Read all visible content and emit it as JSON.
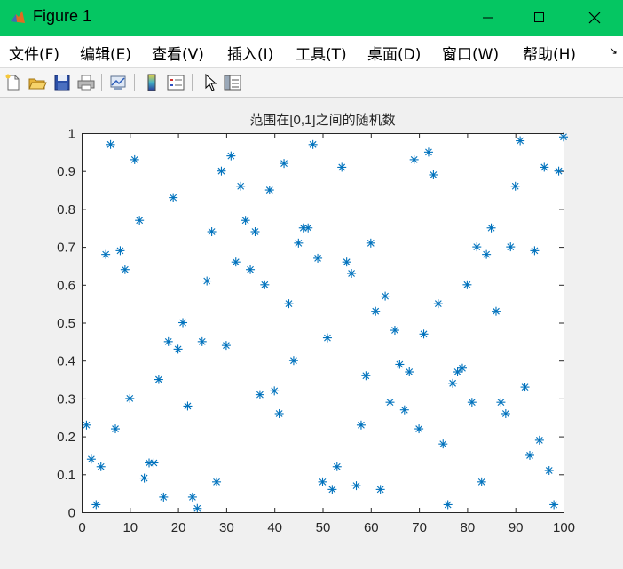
{
  "window": {
    "title": "Figure 1",
    "controls": [
      "minimize",
      "maximize",
      "close"
    ]
  },
  "menu": {
    "items": [
      "文件(F)",
      "编辑(E)",
      "查看(V)",
      "插入(I)",
      "工具(T)",
      "桌面(D)",
      "窗口(W)",
      "帮助(H)"
    ]
  },
  "toolbar": {
    "icons": [
      "new-figure-icon",
      "open-file-icon",
      "save-icon",
      "print-icon",
      "link-plot-icon",
      "colorbar-icon",
      "legend-icon",
      "pointer-icon",
      "property-inspector-icon"
    ]
  },
  "colors": {
    "titlebar": "#05c662",
    "marker": "#0072bd",
    "axes_bg": "#ffffff"
  },
  "chart_data": {
    "type": "scatter",
    "title": "范围在[0,1]之间的随机数",
    "marker": "*",
    "xlim": [
      0,
      100
    ],
    "ylim": [
      0,
      1
    ],
    "xticks": [
      0,
      10,
      20,
      30,
      40,
      50,
      60,
      70,
      80,
      90,
      100
    ],
    "yticks": [
      0,
      0.1,
      0.2,
      0.3,
      0.4,
      0.5,
      0.6,
      0.7,
      0.8,
      0.9,
      1
    ],
    "grid": false,
    "x": [
      1,
      2,
      3,
      4,
      5,
      6,
      7,
      8,
      9,
      10,
      11,
      12,
      13,
      14,
      15,
      16,
      17,
      18,
      19,
      20,
      21,
      22,
      23,
      24,
      25,
      26,
      27,
      28,
      29,
      30,
      31,
      32,
      33,
      34,
      35,
      36,
      37,
      38,
      39,
      40,
      41,
      42,
      43,
      44,
      45,
      46,
      47,
      48,
      49,
      50,
      51,
      52,
      53,
      54,
      55,
      56,
      57,
      58,
      59,
      60,
      61,
      62,
      63,
      64,
      65,
      66,
      67,
      68,
      69,
      70,
      71,
      72,
      73,
      74,
      75,
      76,
      77,
      78,
      79,
      80,
      81,
      82,
      83,
      84,
      85,
      86,
      87,
      88,
      89,
      90,
      91,
      92,
      93,
      94,
      95,
      96,
      97,
      98,
      99,
      100
    ],
    "y": [
      0.23,
      0.14,
      0.02,
      0.12,
      0.68,
      0.97,
      0.22,
      0.69,
      0.64,
      0.3,
      0.93,
      0.77,
      0.09,
      0.13,
      0.13,
      0.35,
      0.04,
      0.45,
      0.83,
      0.43,
      0.5,
      0.28,
      0.04,
      0.01,
      0.45,
      0.61,
      0.74,
      0.08,
      0.9,
      0.44,
      0.94,
      0.66,
      0.86,
      0.77,
      0.64,
      0.74,
      0.31,
      0.6,
      0.85,
      0.32,
      0.26,
      0.92,
      0.55,
      0.4,
      0.71,
      0.75,
      0.75,
      0.97,
      0.67,
      0.08,
      0.46,
      0.06,
      0.12,
      0.91,
      0.66,
      0.63,
      0.07,
      0.23,
      0.36,
      0.71,
      0.53,
      0.06,
      0.57,
      0.29,
      0.48,
      0.39,
      0.27,
      0.37,
      0.93,
      0.22,
      0.47,
      0.95,
      0.89,
      0.55,
      0.18,
      0.02,
      0.34,
      0.37,
      0.38,
      0.6,
      0.29,
      0.7,
      0.08,
      0.68,
      0.75,
      0.53,
      0.29,
      0.26,
      0.7,
      0.86,
      0.98,
      0.33,
      0.15,
      0.69,
      0.19,
      0.91,
      0.11,
      0.02,
      0.9,
      0.99
    ]
  }
}
